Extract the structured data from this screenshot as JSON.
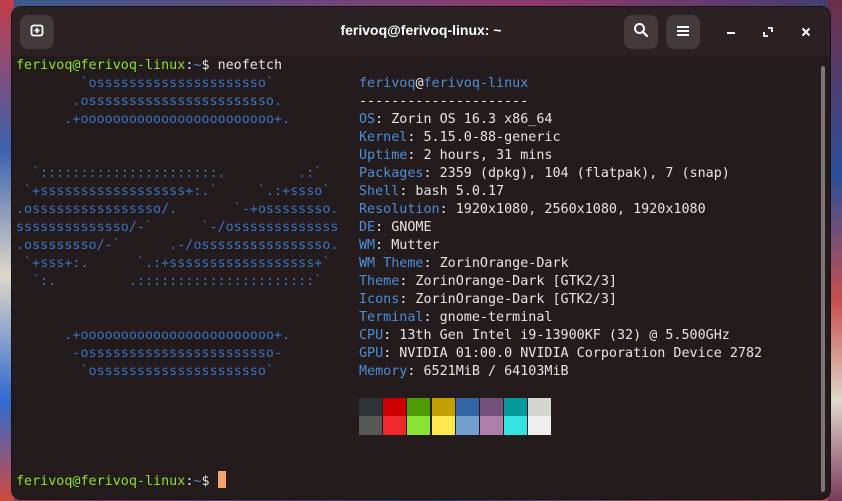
{
  "window": {
    "title": "ferivoq@ferivoq-linux: ~"
  },
  "titlebar": {
    "new_tab_icon": "new-tab-icon",
    "search_icon": "search-icon",
    "menu_icon": "hamburger-menu-icon",
    "minimize_icon": "minimize-icon",
    "maximize_icon": "maximize-icon",
    "close_icon": "close-icon"
  },
  "prompt": {
    "user_host": "ferivoq@ferivoq-linux",
    "path": "~",
    "symbol": "$",
    "command": "neofetch"
  },
  "logo_lines": [
    "        `osssssssssssssssssssso`",
    "       .osssssssssssssssssssssso.",
    "      .+oooooooooooooooooooooooo+.",
    "",
    "",
    "  `::::::::::::::::::::::.         .:`",
    " `+ssssssssssssssssss+:.`     `.:+ssso`",
    ".ossssssssssssssso/.       `-+ossssssso.",
    "ssssssssssssso/-`      `-/osssssssssssss",
    ".ossssssso/-`      .-/ossssssssssssssso.",
    " `+sss+:.      `.:+ssssssssssssssssss+`",
    "  `:.         .::::::::::::::::::::::`",
    "",
    "",
    "      .+oooooooooooooooooooooooo+.",
    "       -osssssssssssssssssssssso-",
    "        `osssssssssssssssssssso`"
  ],
  "info": {
    "user": "ferivoq",
    "at": "@",
    "host": "ferivoq-linux",
    "separator": "---------------------",
    "rows": [
      {
        "key": "OS",
        "value": ": Zorin OS 16.3 x86_64"
      },
      {
        "key": "Kernel",
        "value": ": 5.15.0-88-generic"
      },
      {
        "key": "Uptime",
        "value": ": 2 hours, 31 mins"
      },
      {
        "key": "Packages",
        "value": ": 2359 (dpkg), 104 (flatpak), 7 (snap)"
      },
      {
        "key": "Shell",
        "value": ": bash 5.0.17"
      },
      {
        "key": "Resolution",
        "value": ": 1920x1080, 2560x1080, 1920x1080"
      },
      {
        "key": "DE",
        "value": ": GNOME"
      },
      {
        "key": "WM",
        "value": ": Mutter"
      },
      {
        "key": "WM Theme",
        "value": ": ZorinOrange-Dark"
      },
      {
        "key": "Theme",
        "value": ": ZorinOrange-Dark [GTK2/3]"
      },
      {
        "key": "Icons",
        "value": ": ZorinOrange-Dark [GTK2/3]"
      },
      {
        "key": "Terminal",
        "value": ": gnome-terminal"
      },
      {
        "key": "CPU",
        "value": ": 13th Gen Intel i9-13900KF (32) @ 5.500GHz"
      },
      {
        "key": "GPU",
        "value": ": NVIDIA 01:00.0 NVIDIA Corporation Device 2782"
      },
      {
        "key": "Memory",
        "value": ": 6521MiB / 64103MiB"
      }
    ]
  },
  "palette": {
    "row1": [
      "#2e3436",
      "#cc0000",
      "#4e9a06",
      "#c4a000",
      "#3465a4",
      "#75507b",
      "#06989a",
      "#d3d7cf"
    ],
    "row2": [
      "#555753",
      "#ef2929",
      "#8ae234",
      "#fce94f",
      "#729fcf",
      "#ad7fa8",
      "#34e2e2",
      "#eeeeec"
    ]
  }
}
